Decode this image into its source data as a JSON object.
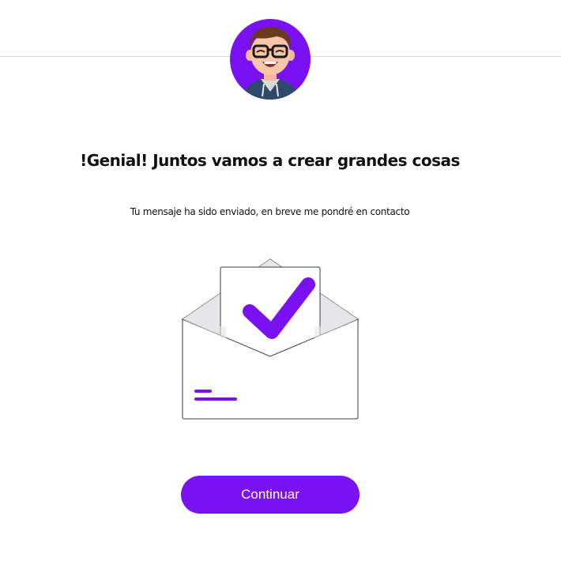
{
  "header": {
    "avatar_icon": "cartoon-avatar-icon"
  },
  "main": {
    "title": "!Genial! Juntos vamos a crear grandes cosas",
    "message": "Tu mensaje ha sido enviado, en breve me pondré en contacto",
    "illustration_icon": "envelope-checkmark-icon",
    "continue_label": "Continuar"
  },
  "colors": {
    "accent": "#7911f3",
    "text": "#111111",
    "divider": "#d9d9d9"
  }
}
